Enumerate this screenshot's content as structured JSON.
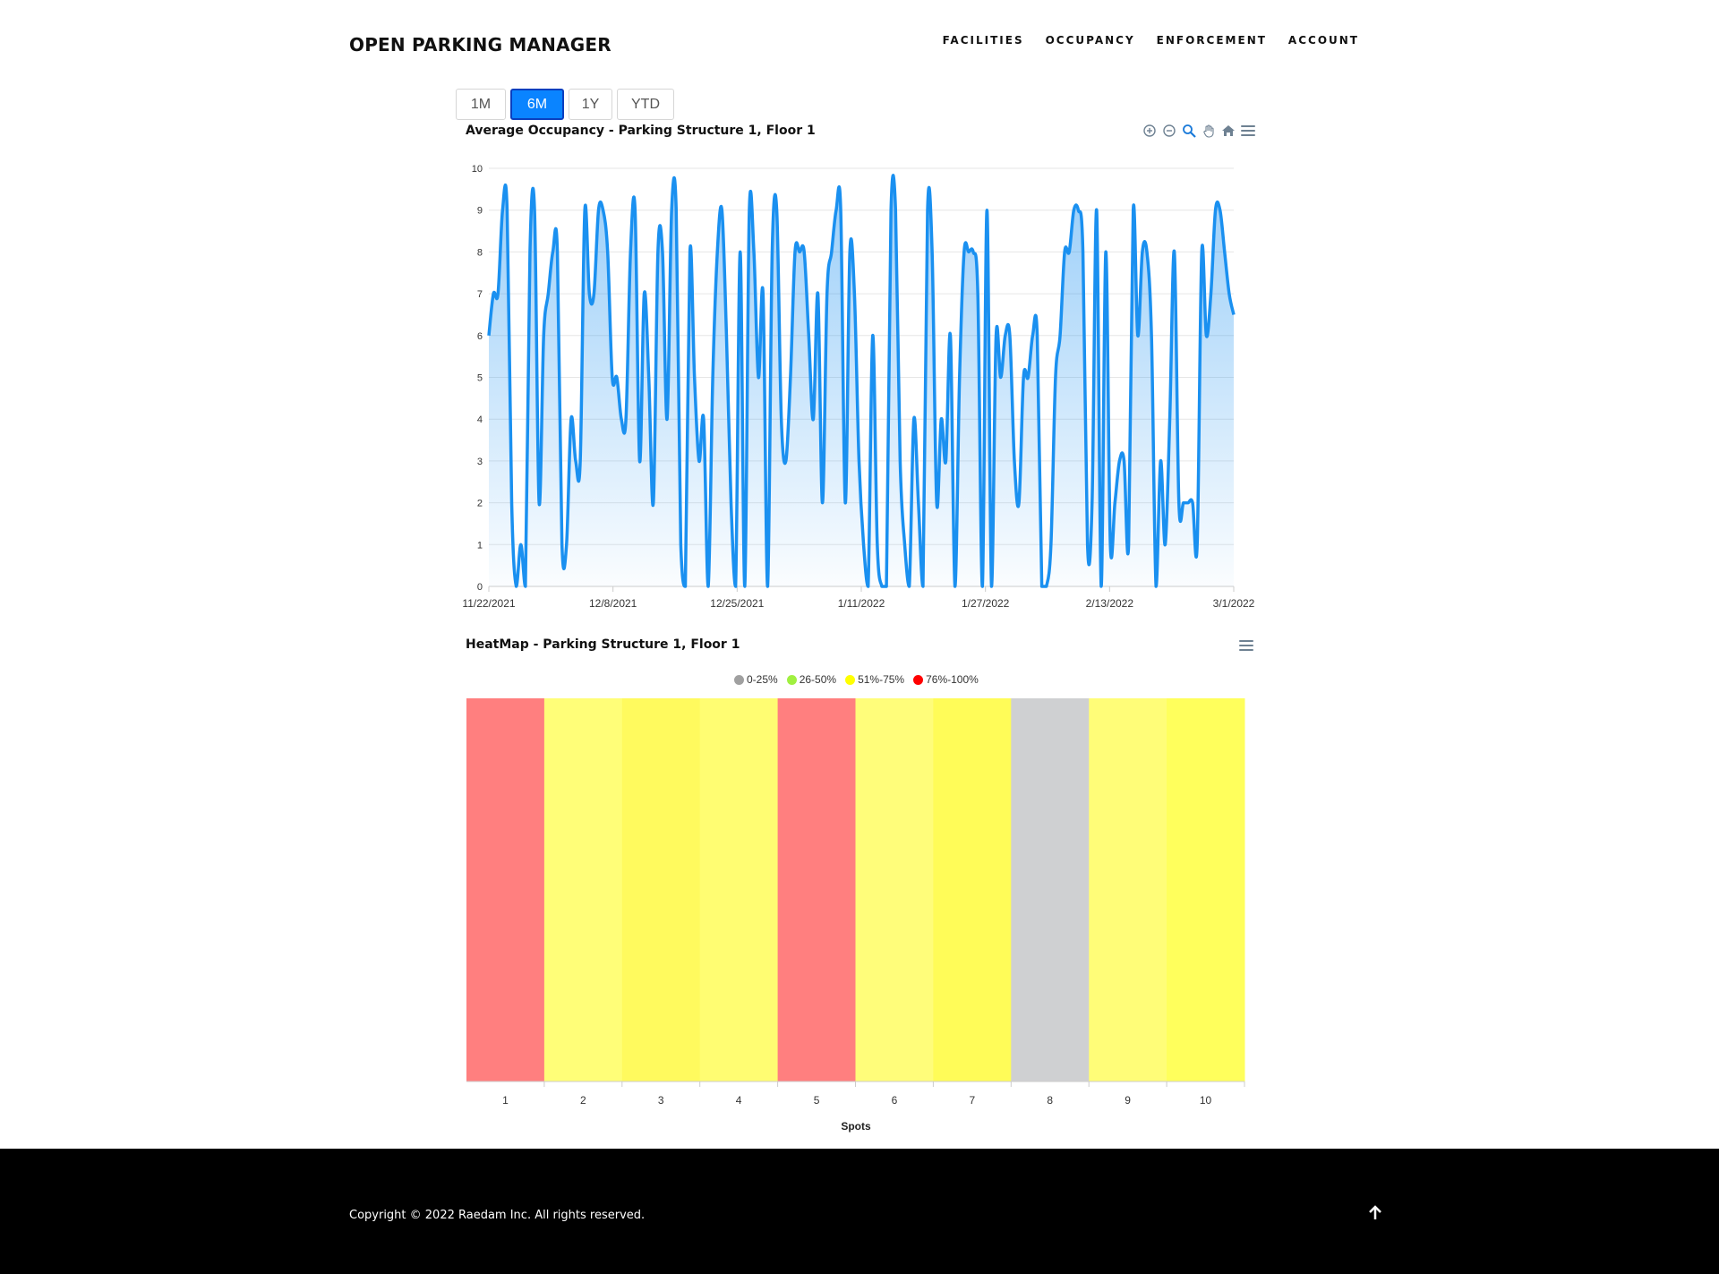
{
  "header": {
    "brand": "OPEN PARKING MANAGER",
    "nav": [
      "FACILITIES",
      "OCCUPANCY",
      "ENFORCEMENT",
      "ACCOUNT"
    ]
  },
  "range_buttons": {
    "items": [
      "1M",
      "6M",
      "1Y",
      "YTD"
    ],
    "active": "6M"
  },
  "colors": {
    "line": "#1a90f0",
    "active_button": "#0a84ff",
    "heat_red": "#ff7f7f",
    "heat_yellow": "#ffff66",
    "heat_grey": "#cfd0d2"
  },
  "icons": [
    "zoom-in-icon",
    "zoom-out-icon",
    "zoom-select-icon",
    "pan-icon",
    "home-icon",
    "menu-icon"
  ],
  "line_chart": {
    "title": "Average Occupancy - Parking Structure 1, Floor 1"
  },
  "heatmap": {
    "title": "HeatMap - Parking Structure 1, Floor 1",
    "legend": [
      {
        "label": "0-25%",
        "color": "#a0a0a0"
      },
      {
        "label": "26-50%",
        "color": "#a0f040"
      },
      {
        "label": "51%-75%",
        "color": "#ffff00"
      },
      {
        "label": "76%-100%",
        "color": "#ff0000"
      }
    ]
  },
  "chart_data": [
    {
      "type": "area",
      "title": "Average Occupancy - Parking Structure 1, Floor 1",
      "xlabel": "",
      "ylabel": "",
      "ylim": [
        0,
        10
      ],
      "yticks": [
        0,
        1,
        2,
        3,
        4,
        5,
        6,
        7,
        8,
        9,
        10
      ],
      "x_tick_labels": [
        "11/22/2021",
        "12/8/2021",
        "12/25/2021",
        "1/11/2022",
        "1/27/2022",
        "2/13/2022",
        "3/1/2022"
      ],
      "grid": true,
      "series": [
        {
          "values": [
            6,
            7,
            7,
            9,
            9,
            2,
            0,
            1,
            0,
            8,
            9,
            2,
            6,
            7,
            8,
            8,
            1,
            1,
            4,
            3,
            3,
            9,
            7,
            7,
            9,
            9,
            8,
            5,
            5,
            4,
            4,
            8,
            9,
            3,
            7,
            5,
            2,
            8,
            8,
            4,
            9,
            9,
            1,
            0,
            8,
            5,
            3,
            4,
            0,
            5,
            8,
            9,
            6,
            2,
            0,
            8,
            0,
            9,
            8,
            5,
            7,
            0,
            8,
            9,
            4,
            3,
            5,
            8,
            8,
            8,
            6,
            4,
            7,
            2,
            7,
            8,
            9,
            9,
            2,
            8,
            7,
            3,
            1,
            0,
            6,
            1,
            0,
            0,
            9,
            9,
            3,
            1,
            0,
            4,
            2,
            0,
            9,
            8,
            2,
            4,
            3,
            6,
            0,
            5,
            8,
            8,
            8,
            7,
            0,
            9,
            0,
            6,
            5,
            6,
            6,
            3,
            2,
            5,
            5,
            6,
            6,
            0,
            0,
            1,
            5,
            6,
            8,
            8,
            9,
            9,
            8,
            1,
            2,
            9,
            0,
            8,
            1,
            2,
            3,
            3,
            1,
            9,
            6,
            8,
            8,
            6,
            0,
            3,
            1,
            4,
            8,
            2,
            2,
            2,
            2,
            1,
            8,
            6,
            7,
            9,
            9,
            8,
            7,
            6.5
          ]
        }
      ]
    },
    {
      "type": "heatmap",
      "title": "HeatMap - Parking Structure 1, Floor 1",
      "xlabel": "Spots",
      "categories": [
        "1",
        "2",
        "3",
        "4",
        "5",
        "6",
        "7",
        "8",
        "9",
        "10"
      ],
      "values_bucket": [
        "76%-100%",
        "51%-75%",
        "51%-75%",
        "51%-75%",
        "76%-100%",
        "51%-75%",
        "51%-75%",
        "0-25%",
        "51%-75%",
        "51%-75%"
      ],
      "colors": [
        "#ff7f7f",
        "#fffe78",
        "#fffa5e",
        "#fffd72",
        "#ff7f7f",
        "#fffd7a",
        "#fffc58",
        "#cfd0d2",
        "#fffd78",
        "#ffff5c"
      ],
      "legend": [
        "0-25%",
        "26-50%",
        "51%-75%",
        "76%-100%"
      ],
      "legend_placement": "top"
    }
  ],
  "footer": {
    "copyright": "Copyright © 2022 Raedam Inc. All rights reserved."
  }
}
